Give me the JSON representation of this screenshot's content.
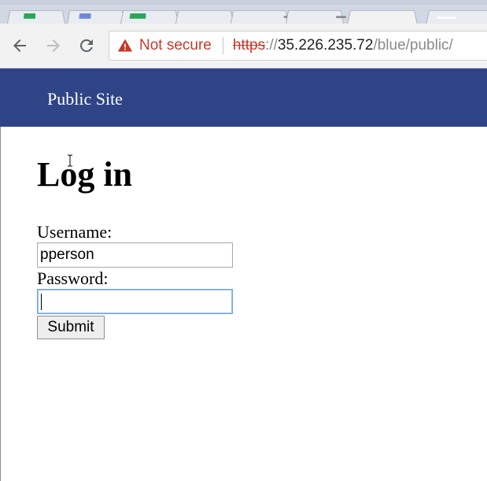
{
  "browser": {
    "address": {
      "security_label": "Not secure",
      "scheme": "https",
      "separator": "://",
      "host": "35.226.235.72",
      "path": "/blue/public/"
    },
    "icons": {
      "back": "arrow-left-icon",
      "forward": "arrow-right-icon",
      "reload": "reload-icon",
      "security": "warning-triangle-icon"
    }
  },
  "site": {
    "title": "Public Site",
    "header_color": "#2f4487"
  },
  "login": {
    "heading": "Log in",
    "username_label": "Username:",
    "username_value": "pperson",
    "password_label": "Password:",
    "password_value": "",
    "submit_label": "Submit"
  }
}
